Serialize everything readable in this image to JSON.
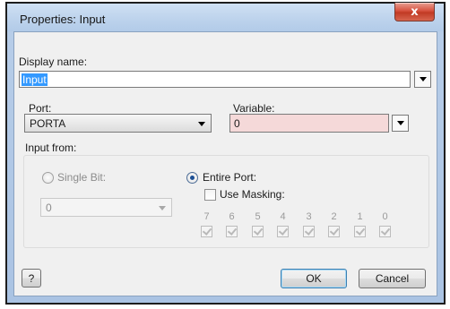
{
  "window": {
    "title": "Properties: Input",
    "close_glyph": "x"
  },
  "display_name": {
    "label": "Display name:",
    "value": "Input"
  },
  "port": {
    "label": "Port:",
    "selected": "PORTA"
  },
  "variable": {
    "label": "Variable:",
    "value": "0",
    "background": "#f5d9d9"
  },
  "input_from": {
    "label": "Input from:",
    "single_bit": {
      "label": "Single Bit:",
      "checked": false,
      "bit_value": "0",
      "enabled": false
    },
    "entire_port": {
      "label": "Entire Port:",
      "checked": true
    },
    "use_masking": {
      "label": "Use Masking:",
      "checked": false
    },
    "bits": [
      "7",
      "6",
      "5",
      "4",
      "3",
      "2",
      "1",
      "0"
    ]
  },
  "buttons": {
    "help": "?",
    "ok": "OK",
    "cancel": "Cancel"
  }
}
